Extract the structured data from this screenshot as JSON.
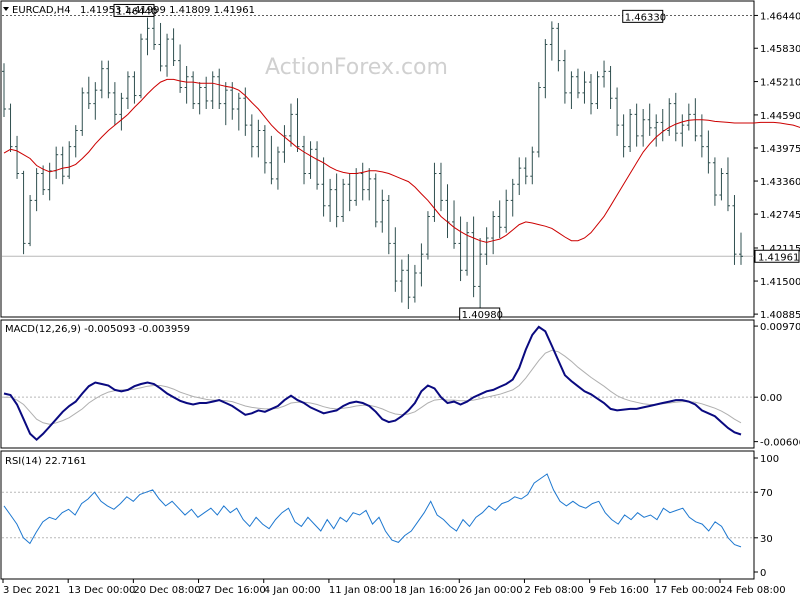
{
  "header": {
    "symbol": "EURCAD,H4",
    "ohlc": "1.41953 1.41999 1.41809 1.41961",
    "watermark": "ActionForex.com"
  },
  "colors": {
    "price_bars": "#2f4f4f",
    "ma": "#cc0000",
    "macd_main": "#0a0a80",
    "macd_signal": "#b0b0b0",
    "rsi": "#1e78d0",
    "grid": "#b8b8b8",
    "frame": "#000000",
    "label_box_fill": "#ffffff",
    "current_price_fill": "#ffffff"
  },
  "chart_data": [
    {
      "type": "ohlc",
      "panel": "price",
      "y_ticks": [
        "1.46440",
        "1.45830",
        "1.45210",
        "1.44590",
        "1.43975",
        "1.43360",
        "1.42745",
        "1.42115",
        "1.41500",
        "1.40885"
      ],
      "ylim": [
        1.4085,
        1.4669
      ],
      "reference_lines": {
        "high_dotted": "1.46440",
        "current": "1.41961"
      },
      "annotations": [
        {
          "text": "1.46440",
          "x_bar": 23,
          "value": 1.4644
        },
        {
          "text": "1.40980",
          "x_bar": 76,
          "value": 1.4098
        },
        {
          "text": "1.46330",
          "x_bar": 101,
          "value": 1.4633
        }
      ],
      "current_price_label": "1.41961",
      "moving_average": [
        1.4388,
        1.4395,
        1.4392,
        1.4385,
        1.4378,
        1.4365,
        1.4358,
        1.4353,
        1.4356,
        1.436,
        1.4362,
        1.4367,
        1.4378,
        1.439,
        1.4405,
        1.4418,
        1.443,
        1.444,
        1.445,
        1.446,
        1.4473,
        1.4485,
        1.4498,
        1.451,
        1.452,
        1.4525,
        1.4525,
        1.4522,
        1.452,
        1.452,
        1.4518,
        1.4518,
        1.4518,
        1.4515,
        1.4512,
        1.451,
        1.4505,
        1.4495,
        1.4482,
        1.447,
        1.4455,
        1.444,
        1.4428,
        1.4418,
        1.4408,
        1.4398,
        1.439,
        1.4383,
        1.4376,
        1.437,
        1.4362,
        1.4356,
        1.4352,
        1.435,
        1.435,
        1.4352,
        1.4355,
        1.4355,
        1.4353,
        1.435,
        1.4345,
        1.434,
        1.4335,
        1.4325,
        1.4312,
        1.43,
        1.4285,
        1.427,
        1.426,
        1.425,
        1.4242,
        1.4235,
        1.423,
        1.4225,
        1.4222,
        1.4225,
        1.4228,
        1.4235,
        1.4245,
        1.4255,
        1.426,
        1.4258,
        1.4255,
        1.4252,
        1.4248,
        1.424,
        1.4232,
        1.4225,
        1.4225,
        1.423,
        1.424,
        1.4255,
        1.427,
        1.429,
        1.431,
        1.433,
        1.435,
        1.437,
        1.439,
        1.4405,
        1.4418,
        1.4428,
        1.4436,
        1.4442,
        1.4446,
        1.4449,
        1.445,
        1.445,
        1.4449,
        1.4447,
        1.4446,
        1.4445,
        1.4444,
        1.4444,
        1.4444,
        1.4444,
        1.4445,
        1.4445,
        1.4445,
        1.4444,
        1.4442,
        1.444,
        1.4436,
        1.443,
        1.4418,
        1.4405,
        1.439,
        1.4374,
        1.4358
      ],
      "bars": [
        [
          1.454,
          1.4555,
          1.4455,
          1.447
        ],
        [
          1.447,
          1.448,
          1.439,
          1.44
        ],
        [
          1.44,
          1.442,
          1.434,
          1.435
        ],
        [
          1.435,
          1.4355,
          1.42,
          1.422
        ],
        [
          1.422,
          1.431,
          1.4215,
          1.43
        ],
        [
          1.43,
          1.436,
          1.428,
          1.435
        ],
        [
          1.435,
          1.4365,
          1.431,
          1.432
        ],
        [
          1.432,
          1.437,
          1.43,
          1.4355
        ],
        [
          1.4355,
          1.44,
          1.434,
          1.4385
        ],
        [
          1.4385,
          1.44,
          1.433,
          1.4345
        ],
        [
          1.4345,
          1.441,
          1.434,
          1.44
        ],
        [
          1.44,
          1.444,
          1.438,
          1.443
        ],
        [
          1.443,
          1.451,
          1.442,
          1.45
        ],
        [
          1.45,
          1.453,
          1.447,
          1.448
        ],
        [
          1.448,
          1.452,
          1.445,
          1.4505
        ],
        [
          1.4505,
          1.456,
          1.449,
          1.4545
        ],
        [
          1.4545,
          1.456,
          1.449,
          1.45
        ],
        [
          1.45,
          1.452,
          1.444,
          1.446
        ],
        [
          1.446,
          1.45,
          1.443,
          1.449
        ],
        [
          1.449,
          1.454,
          1.447,
          1.453
        ],
        [
          1.453,
          1.454,
          1.448,
          1.4495
        ],
        [
          1.4495,
          1.461,
          1.449,
          1.46
        ],
        [
          1.46,
          1.464,
          1.457,
          1.462
        ],
        [
          1.462,
          1.4644,
          1.458,
          1.459
        ],
        [
          1.459,
          1.463,
          1.454,
          1.455
        ],
        [
          1.455,
          1.461,
          1.453,
          1.46
        ],
        [
          1.46,
          1.462,
          1.455,
          1.456
        ],
        [
          1.456,
          1.459,
          1.45,
          1.451
        ],
        [
          1.451,
          1.455,
          1.448,
          1.453
        ],
        [
          1.453,
          1.454,
          1.447,
          1.448
        ],
        [
          1.448,
          1.452,
          1.446,
          1.451
        ],
        [
          1.451,
          1.453,
          1.447,
          1.4485
        ],
        [
          1.4485,
          1.454,
          1.447,
          1.453
        ],
        [
          1.453,
          1.4545,
          1.447,
          1.448
        ],
        [
          1.448,
          1.452,
          1.444,
          1.4505
        ],
        [
          1.4505,
          1.452,
          1.445,
          1.447
        ],
        [
          1.447,
          1.45,
          1.443,
          1.449
        ],
        [
          1.449,
          1.451,
          1.442,
          1.444
        ],
        [
          1.444,
          1.446,
          1.438,
          1.44
        ],
        [
          1.44,
          1.445,
          1.438,
          1.443
        ],
        [
          1.443,
          1.444,
          1.435,
          1.437
        ],
        [
          1.437,
          1.442,
          1.433,
          1.434
        ],
        [
          1.434,
          1.44,
          1.432,
          1.439
        ],
        [
          1.439,
          1.444,
          1.437,
          1.442
        ],
        [
          1.442,
          1.448,
          1.44,
          1.446
        ],
        [
          1.446,
          1.449,
          1.439,
          1.44
        ],
        [
          1.44,
          1.442,
          1.433,
          1.435
        ],
        [
          1.435,
          1.441,
          1.434,
          1.4395
        ],
        [
          1.4395,
          1.441,
          1.432,
          1.433
        ],
        [
          1.433,
          1.438,
          1.427,
          1.429
        ],
        [
          1.429,
          1.434,
          1.426,
          1.432
        ],
        [
          1.432,
          1.435,
          1.425,
          1.427
        ],
        [
          1.427,
          1.434,
          1.426,
          1.433
        ],
        [
          1.433,
          1.435,
          1.428,
          1.43
        ],
        [
          1.43,
          1.436,
          1.429,
          1.435
        ],
        [
          1.435,
          1.437,
          1.43,
          1.432
        ],
        [
          1.432,
          1.436,
          1.43,
          1.434
        ],
        [
          1.434,
          1.435,
          1.425,
          1.426
        ],
        [
          1.426,
          1.432,
          1.424,
          1.43
        ],
        [
          1.43,
          1.431,
          1.42,
          1.422
        ],
        [
          1.422,
          1.425,
          1.413,
          1.415
        ],
        [
          1.415,
          1.419,
          1.411,
          1.417
        ],
        [
          1.417,
          1.42,
          1.4098,
          1.412
        ],
        [
          1.412,
          1.418,
          1.411,
          1.4165
        ],
        [
          1.4165,
          1.422,
          1.414,
          1.42
        ],
        [
          1.42,
          1.428,
          1.419,
          1.427
        ],
        [
          1.427,
          1.437,
          1.426,
          1.435
        ],
        [
          1.435,
          1.437,
          1.428,
          1.43
        ],
        [
          1.43,
          1.433,
          1.423,
          1.426
        ],
        [
          1.426,
          1.43,
          1.421,
          1.422
        ],
        [
          1.422,
          1.427,
          1.415,
          1.417
        ],
        [
          1.417,
          1.426,
          1.416,
          1.424
        ],
        [
          1.424,
          1.427,
          1.412,
          1.414
        ],
        [
          1.414,
          1.423,
          1.41,
          1.42
        ],
        [
          1.42,
          1.425,
          1.418,
          1.423
        ],
        [
          1.423,
          1.428,
          1.42,
          1.427
        ],
        [
          1.427,
          1.43,
          1.423,
          1.425
        ],
        [
          1.425,
          1.432,
          1.424,
          1.43
        ],
        [
          1.43,
          1.434,
          1.427,
          1.433
        ],
        [
          1.433,
          1.438,
          1.431,
          1.436
        ],
        [
          1.436,
          1.438,
          1.433,
          1.4345
        ],
        [
          1.4345,
          1.44,
          1.433,
          1.439
        ],
        [
          1.439,
          1.452,
          1.438,
          1.451
        ],
        [
          1.451,
          1.46,
          1.449,
          1.459
        ],
        [
          1.459,
          1.4633,
          1.456,
          1.462
        ],
        [
          1.462,
          1.463,
          1.454,
          1.456
        ],
        [
          1.456,
          1.458,
          1.448,
          1.45
        ],
        [
          1.45,
          1.454,
          1.447,
          1.453
        ],
        [
          1.453,
          1.4545,
          1.449,
          1.45
        ],
        [
          1.45,
          1.454,
          1.448,
          1.452
        ],
        [
          1.452,
          1.4535,
          1.446,
          1.448
        ],
        [
          1.448,
          1.454,
          1.447,
          1.453
        ],
        [
          1.453,
          1.456,
          1.451,
          1.454
        ],
        [
          1.454,
          1.455,
          1.447,
          1.449
        ],
        [
          1.449,
          1.451,
          1.442,
          1.444
        ],
        [
          1.444,
          1.446,
          1.438,
          1.44
        ],
        [
          1.44,
          1.447,
          1.439,
          1.446
        ],
        [
          1.446,
          1.448,
          1.44,
          1.442
        ],
        [
          1.442,
          1.447,
          1.44,
          1.445
        ],
        [
          1.445,
          1.448,
          1.442,
          1.4435
        ],
        [
          1.4435,
          1.446,
          1.44,
          1.4445
        ],
        [
          1.4445,
          1.447,
          1.441,
          1.443
        ],
        [
          1.443,
          1.449,
          1.442,
          1.448
        ],
        [
          1.448,
          1.45,
          1.441,
          1.4425
        ],
        [
          1.4425,
          1.446,
          1.44,
          1.444
        ],
        [
          1.444,
          1.448,
          1.443,
          1.446
        ],
        [
          1.446,
          1.449,
          1.441,
          1.442
        ],
        [
          1.442,
          1.446,
          1.438,
          1.44
        ],
        [
          1.44,
          1.443,
          1.435,
          1.437
        ],
        [
          1.437,
          1.438,
          1.429,
          1.431
        ],
        [
          1.431,
          1.436,
          1.43,
          1.435
        ],
        [
          1.435,
          1.438,
          1.428,
          1.429
        ],
        [
          1.429,
          1.431,
          1.418,
          1.42
        ],
        [
          1.42,
          1.424,
          1.418,
          1.4196
        ]
      ]
    },
    {
      "type": "line",
      "panel": "macd",
      "label": "MACD(12,26,9) -0.005093 -0.003959",
      "y_ticks": [
        "0.009706",
        "0.00",
        "-0.006067"
      ],
      "ylim": [
        -0.0068,
        0.0104
      ],
      "main": [
        0.0005,
        0.0003,
        -0.001,
        -0.003,
        -0.005,
        -0.0058,
        -0.005,
        -0.004,
        -0.003,
        -0.002,
        -0.0012,
        -0.0006,
        0.0005,
        0.0015,
        0.002,
        0.0018,
        0.0016,
        0.001,
        0.0008,
        0.001,
        0.0015,
        0.0018,
        0.002,
        0.0018,
        0.0012,
        0.0005,
        0.0,
        -0.0005,
        -0.0008,
        -0.001,
        -0.0008,
        -0.0008,
        -0.0006,
        -0.0004,
        -0.0008,
        -0.0012,
        -0.0018,
        -0.0024,
        -0.0022,
        -0.0018,
        -0.002,
        -0.0016,
        -0.0012,
        -0.0004,
        0.0002,
        -0.0004,
        -0.0008,
        -0.0014,
        -0.0018,
        -0.0022,
        -0.002,
        -0.0018,
        -0.0012,
        -0.0008,
        -0.0006,
        -0.0008,
        -0.0012,
        -0.002,
        -0.003,
        -0.0034,
        -0.0032,
        -0.0026,
        -0.0018,
        -0.0008,
        0.0008,
        0.0016,
        0.0012,
        0.0,
        -0.0008,
        -0.0006,
        -0.001,
        -0.0006,
        0.0,
        0.0004,
        0.0008,
        0.001,
        0.0014,
        0.0018,
        0.0024,
        0.004,
        0.0065,
        0.0085,
        0.0096,
        0.009,
        0.007,
        0.005,
        0.003,
        0.0022,
        0.0015,
        0.0008,
        0.0004,
        -0.0002,
        -0.0008,
        -0.0016,
        -0.0018,
        -0.0017,
        -0.0016,
        -0.0016,
        -0.0014,
        -0.0012,
        -0.001,
        -0.0008,
        -0.0006,
        -0.0004,
        -0.0004,
        -0.0006,
        -0.001,
        -0.0018,
        -0.0022,
        -0.0026,
        -0.0034,
        -0.0042,
        -0.0048,
        -0.0051
      ],
      "signal": [
        0.0,
        0.0,
        -0.0004,
        -0.001,
        -0.002,
        -0.003,
        -0.0035,
        -0.0037,
        -0.0035,
        -0.0032,
        -0.0028,
        -0.0022,
        -0.0016,
        -0.0008,
        -0.0002,
        0.0003,
        0.0007,
        0.0009,
        0.001,
        0.001,
        0.0011,
        0.0013,
        0.0015,
        0.0016,
        0.0016,
        0.0014,
        0.0011,
        0.0007,
        0.0004,
        0.0001,
        -0.0001,
        -0.0003,
        -0.0004,
        -0.0004,
        -0.0005,
        -0.0006,
        -0.0009,
        -0.0012,
        -0.0014,
        -0.0015,
        -0.0016,
        -0.0016,
        -0.0015,
        -0.0012,
        -0.0008,
        -0.0007,
        -0.0007,
        -0.0008,
        -0.001,
        -0.0013,
        -0.0015,
        -0.0016,
        -0.0015,
        -0.0014,
        -0.0012,
        -0.0011,
        -0.0011,
        -0.0013,
        -0.0016,
        -0.002,
        -0.0023,
        -0.0024,
        -0.0023,
        -0.002,
        -0.0014,
        -0.0008,
        -0.0004,
        -0.0003,
        -0.0004,
        -0.0004,
        -0.0005,
        -0.0005,
        -0.0004,
        -0.0002,
        0.0,
        0.0002,
        0.0004,
        0.0007,
        0.001,
        0.0016,
        0.0026,
        0.0038,
        0.005,
        0.006,
        0.0064,
        0.0062,
        0.0056,
        0.0049,
        0.0041,
        0.0034,
        0.0027,
        0.0021,
        0.0015,
        0.0008,
        0.0002,
        -0.0002,
        -0.0005,
        -0.0007,
        -0.0009,
        -0.001,
        -0.001,
        -0.0009,
        -0.0008,
        -0.0007,
        -0.0006,
        -0.0006,
        -0.0007,
        -0.0009,
        -0.0012,
        -0.0015,
        -0.0019,
        -0.0024,
        -0.003,
        -0.0035
      ]
    },
    {
      "type": "line",
      "panel": "rsi",
      "label": "RSI(14) 22.7161",
      "y_ticks": [
        "100",
        "70",
        "30",
        "0"
      ],
      "ylim": [
        0,
        100
      ],
      "levels": [
        70,
        30
      ],
      "values": [
        58,
        50,
        42,
        30,
        25,
        35,
        44,
        48,
        46,
        52,
        55,
        50,
        60,
        64,
        70,
        62,
        58,
        55,
        60,
        66,
        62,
        68,
        70,
        72,
        64,
        58,
        62,
        56,
        50,
        55,
        48,
        52,
        56,
        50,
        58,
        52,
        56,
        46,
        40,
        48,
        42,
        38,
        46,
        52,
        56,
        44,
        40,
        48,
        42,
        36,
        46,
        38,
        48,
        44,
        52,
        50,
        54,
        42,
        48,
        36,
        28,
        26,
        32,
        36,
        44,
        52,
        62,
        50,
        46,
        40,
        36,
        46,
        40,
        48,
        52,
        58,
        54,
        60,
        62,
        66,
        64,
        68,
        78,
        82,
        86,
        72,
        62,
        58,
        62,
        58,
        56,
        60,
        62,
        52,
        46,
        42,
        50,
        46,
        52,
        48,
        50,
        46,
        56,
        52,
        54,
        56,
        48,
        44,
        42,
        36,
        44,
        40,
        30,
        24,
        22
      ]
    },
    {
      "type": "time_axis",
      "labels": [
        "3 Dec 2021",
        "13 Dec 00:00",
        "20 Dec 08:00",
        "27 Dec 16:00",
        "4 Jan 00:00",
        "11 Jan 08:00",
        "18 Jan 16:00",
        "26 Jan 00:00",
        "2 Feb 08:00",
        "9 Feb 16:00",
        "17 Feb 00:00",
        "24 Feb 08:00"
      ]
    }
  ]
}
